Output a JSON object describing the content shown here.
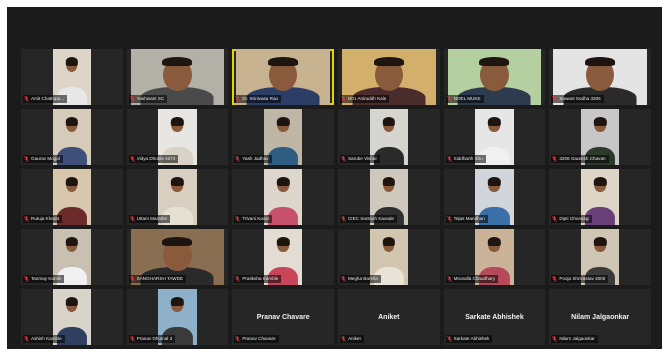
{
  "meeting": {
    "tiles": [
      {
        "name": "Amit Chattopa...",
        "video": "narrow",
        "bg": "#ddd6c8",
        "shirt": "#e8e8e8"
      },
      {
        "name": "Yashwant SC",
        "video": "wide",
        "bg": "#b3b0a8",
        "shirt": "#4a4a4a"
      },
      {
        "name": "Dr. Srinivasa Rao",
        "video": "wide",
        "bg": "#c7b38f",
        "shirt": "#2c3e66",
        "speaking": true
      },
      {
        "name": "D01 Aniruddh Kale",
        "video": "wide",
        "bg": "#d2b06c",
        "shirt": "#4b2c2c"
      },
      {
        "name": "NOEL MUKE",
        "video": "wide",
        "bg": "#b4cfa0",
        "shirt": "#2e3a4e"
      },
      {
        "name": "Sawant Sodha 3306",
        "video": "wide",
        "bg": "#e4e4e4",
        "shirt": "#2a2a2a"
      },
      {
        "name": "Gaurav Mogal",
        "video": "narrow",
        "bg": "#d6cbb8",
        "shirt": "#3e4f7a"
      },
      {
        "name": "Vidya Dhoble 4274",
        "video": "narrow",
        "bg": "#e8e6e2",
        "shirt": "#d9d2c6"
      },
      {
        "name": "Yash Jadhav",
        "video": "narrow",
        "bg": "#bfb6a6",
        "shirt": "#2f5d82"
      },
      {
        "name": "Sarube Vishal",
        "video": "narrow",
        "bg": "#d6d4ce",
        "shirt": "#2a2a2a"
      },
      {
        "name": "Siddharth Shu",
        "video": "narrow",
        "bg": "#e6e6e6",
        "shirt": "#f0f0f0"
      },
      {
        "name": "3206 Gauresh Chavan",
        "video": "narrow",
        "bg": "#c7c7c7",
        "shirt": "#2b3a2b"
      },
      {
        "name": "Rutuja Kharat",
        "video": "narrow",
        "bg": "#d8c6ad",
        "shirt": "#6b2b2b"
      },
      {
        "name": "Uttam Marathe",
        "video": "narrow",
        "bg": "#d8cfc0",
        "shirt": "#e6e0d4"
      },
      {
        "name": "Trivani Kavar",
        "video": "narrow",
        "bg": "#dcd6cc",
        "shirt": "#c7506c"
      },
      {
        "name": "CIEC Santosh Kavade",
        "video": "narrow",
        "bg": "#cfc8bc",
        "shirt": "#2f2f2f"
      },
      {
        "name": "Tejas Mandhan",
        "video": "narrow",
        "bg": "#d0d6dc",
        "shirt": "#3a6fa8"
      },
      {
        "name": "Dipti Ghonasgi",
        "video": "narrow",
        "bg": "#ddd5c6",
        "shirt": "#6a3f7a"
      },
      {
        "name": "Tanmay Karnik",
        "video": "narrow",
        "bg": "#c8c0b0",
        "shirt": "#f0f0f0"
      },
      {
        "name": "SANGHARSH TAWDE",
        "video": "wide",
        "bg": "#8a6e52",
        "shirt": "#2a2a2a"
      },
      {
        "name": "Pratiksha Kamble",
        "video": "narrow",
        "bg": "#e2dcd2",
        "shirt": "#c8455a"
      },
      {
        "name": "Megha Barsha",
        "video": "narrow",
        "bg": "#d2c6b0",
        "shirt": "#e8e4d8"
      },
      {
        "name": "Mrunalla Chaudhary",
        "video": "narrow",
        "bg": "#cbb39a",
        "shirt": "#b74a5a"
      },
      {
        "name": "Pooja Shrivastav 4005",
        "video": "narrow",
        "bg": "#cfc6b4",
        "shirt": "#3a3a3a"
      },
      {
        "name": "Ashish Kamble",
        "video": "narrow",
        "bg": "#d9d4ca",
        "shirt": "#2f3f5f"
      },
      {
        "name": "Pranav Dhumal 3",
        "video": "narrow",
        "bg": "#8fb0c9",
        "shirt": "#3a3a3a"
      },
      {
        "name": "Pranav Chavare",
        "video": "none",
        "display": "Pranav Chavare"
      },
      {
        "name": "Aniket",
        "video": "none",
        "display": "Aniket"
      },
      {
        "name": "Sarkate Abhishek",
        "video": "none",
        "display": "Sarkate Abhishek"
      },
      {
        "name": "Nilam Jalgaonkar",
        "video": "none",
        "display": "Nilam Jalgaonkar"
      }
    ]
  },
  "colors": {
    "background": "#1b1b1b",
    "tile": "#262626",
    "speaker_outline": "#e3d400",
    "muted_icon": "#e0383b"
  },
  "icons": {
    "muted": "mic-muted-icon"
  }
}
